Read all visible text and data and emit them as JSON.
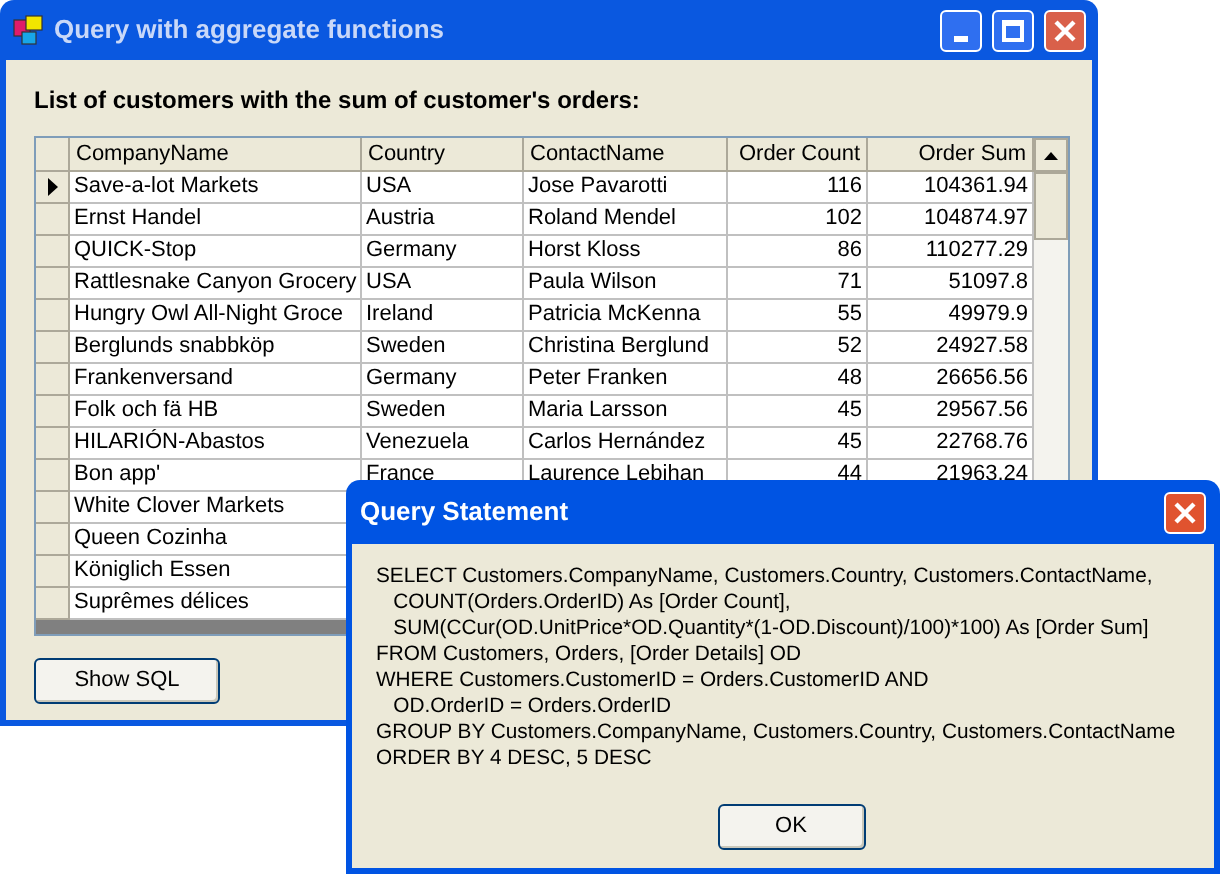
{
  "window": {
    "title": "Query with aggregate functions",
    "heading": "List of customers with the sum of customer's orders:"
  },
  "table": {
    "columns": [
      "CompanyName",
      "Country",
      "ContactName",
      "Order Count",
      "Order Sum"
    ],
    "rows": [
      {
        "selected": true,
        "cells": [
          "Save-a-lot Markets",
          "USA",
          "Jose Pavarotti",
          "116",
          "104361.94"
        ]
      },
      {
        "selected": false,
        "cells": [
          "Ernst Handel",
          "Austria",
          "Roland Mendel",
          "102",
          "104874.97"
        ]
      },
      {
        "selected": false,
        "cells": [
          "QUICK-Stop",
          "Germany",
          "Horst Kloss",
          "86",
          "110277.29"
        ]
      },
      {
        "selected": false,
        "cells": [
          "Rattlesnake Canyon Grocery",
          "USA",
          "Paula Wilson",
          "71",
          "51097.8"
        ]
      },
      {
        "selected": false,
        "cells": [
          "Hungry Owl All-Night Groce",
          "Ireland",
          "Patricia McKenna",
          "55",
          "49979.9"
        ]
      },
      {
        "selected": false,
        "cells": [
          "Berglunds snabbköp",
          "Sweden",
          "Christina Berglund",
          "52",
          "24927.58"
        ]
      },
      {
        "selected": false,
        "cells": [
          "Frankenversand",
          "Germany",
          "Peter Franken",
          "48",
          "26656.56"
        ]
      },
      {
        "selected": false,
        "cells": [
          "Folk och fä HB",
          "Sweden",
          "Maria Larsson",
          "45",
          "29567.56"
        ]
      },
      {
        "selected": false,
        "cells": [
          "HILARIÓN-Abastos",
          "Venezuela",
          "Carlos Hernández",
          "45",
          "22768.76"
        ]
      },
      {
        "selected": false,
        "cells": [
          "Bon app'",
          "France",
          "Laurence Lebihan",
          "44",
          "21963.24"
        ]
      },
      {
        "selected": false,
        "cells": [
          "White Clover Markets"
        ]
      },
      {
        "selected": false,
        "cells": [
          "Queen Cozinha"
        ]
      },
      {
        "selected": false,
        "cells": [
          "Königlich Essen"
        ]
      },
      {
        "selected": false,
        "cells": [
          "Suprêmes délices"
        ]
      }
    ]
  },
  "buttons": [
    "Show SQL"
  ],
  "dialog": {
    "title": "Query Statement",
    "lines": [
      "SELECT Customers.CompanyName, Customers.Country, Customers.ContactName,",
      "   COUNT(Orders.OrderID) As [Order Count],",
      "   SUM(CCur(OD.UnitPrice*OD.Quantity*(1-OD.Discount)/100)*100) As [Order Sum]",
      "FROM Customers, Orders, [Order Details] OD",
      "WHERE Customers.CustomerID = Orders.CustomerID AND",
      "   OD.OrderID = Orders.OrderID",
      "GROUP BY Customers.CompanyName, Customers.Country, Customers.ContactName",
      "ORDER BY 4 DESC, 5 DESC"
    ],
    "buttons": [
      "OK"
    ]
  }
}
